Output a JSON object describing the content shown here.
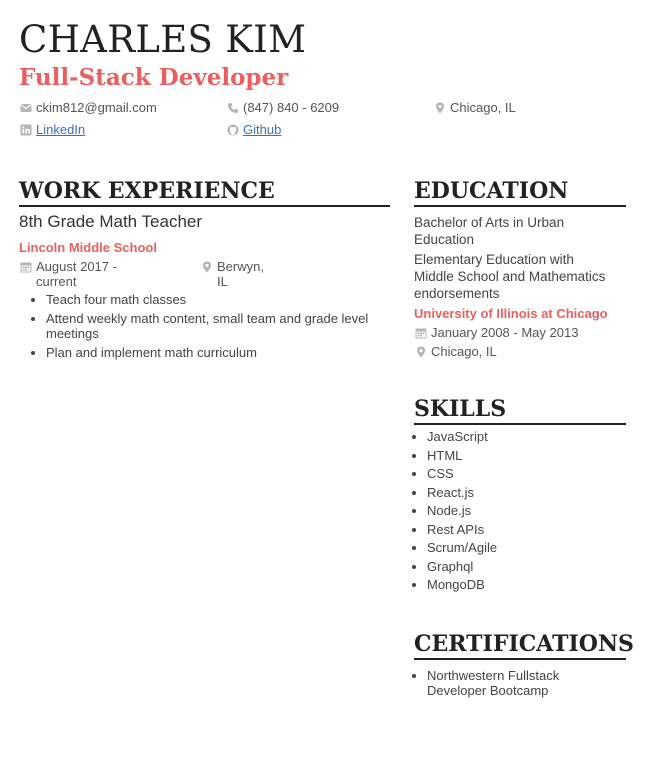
{
  "header": {
    "name": "CHARLES KIM",
    "role": "Full-Stack Developer"
  },
  "contact": {
    "email": "ckim812@gmail.com",
    "phone": "(847) 840 - 6209",
    "location": "Chicago, IL",
    "linkedin": "LinkedIn",
    "github": "Github"
  },
  "work": {
    "heading": "WORK EXPERIENCE",
    "jobs": [
      {
        "title": "8th Grade Math Teacher",
        "company": "Lincoln Middle School",
        "dates_line1": "August 2017 -",
        "dates_line2": "current",
        "location_line1": "Berwyn,",
        "location_line2": "IL",
        "bullets": [
          "Teach four math classes",
          "Attend weekly math content, small team and grade level meetings",
          "Plan and implement math curriculum"
        ]
      }
    ]
  },
  "education": {
    "heading": "EDUCATION",
    "degree1": "Bachelor of Arts in Urban Education",
    "degree2": "Elementary Education with Middle School and Mathematics endorsements",
    "school": "University of Illinois at Chicago",
    "dates": "January 2008 - May 2013",
    "location": "Chicago, IL"
  },
  "skills": {
    "heading": "SKILLS",
    "items": [
      "JavaScript",
      "HTML",
      "CSS",
      "React.js",
      "Node.js",
      "Rest APIs",
      "Scrum/Agile",
      "Graphql",
      "MongoDB"
    ]
  },
  "certifications": {
    "heading": "CERTIFICATIONS",
    "items": [
      "Northwestern Fullstack Developer Bootcamp"
    ]
  },
  "icons": {
    "email": "envelope-icon",
    "phone": "phone-icon",
    "location": "map-pin-icon",
    "linkedin": "linkedin-icon",
    "github": "github-icon",
    "calendar": "calendar-icon"
  },
  "colors": {
    "accent": "#e8605f",
    "text": "#444444",
    "heading": "#222222",
    "link": "#3d6fb6",
    "icon": "#b5b5b5"
  }
}
